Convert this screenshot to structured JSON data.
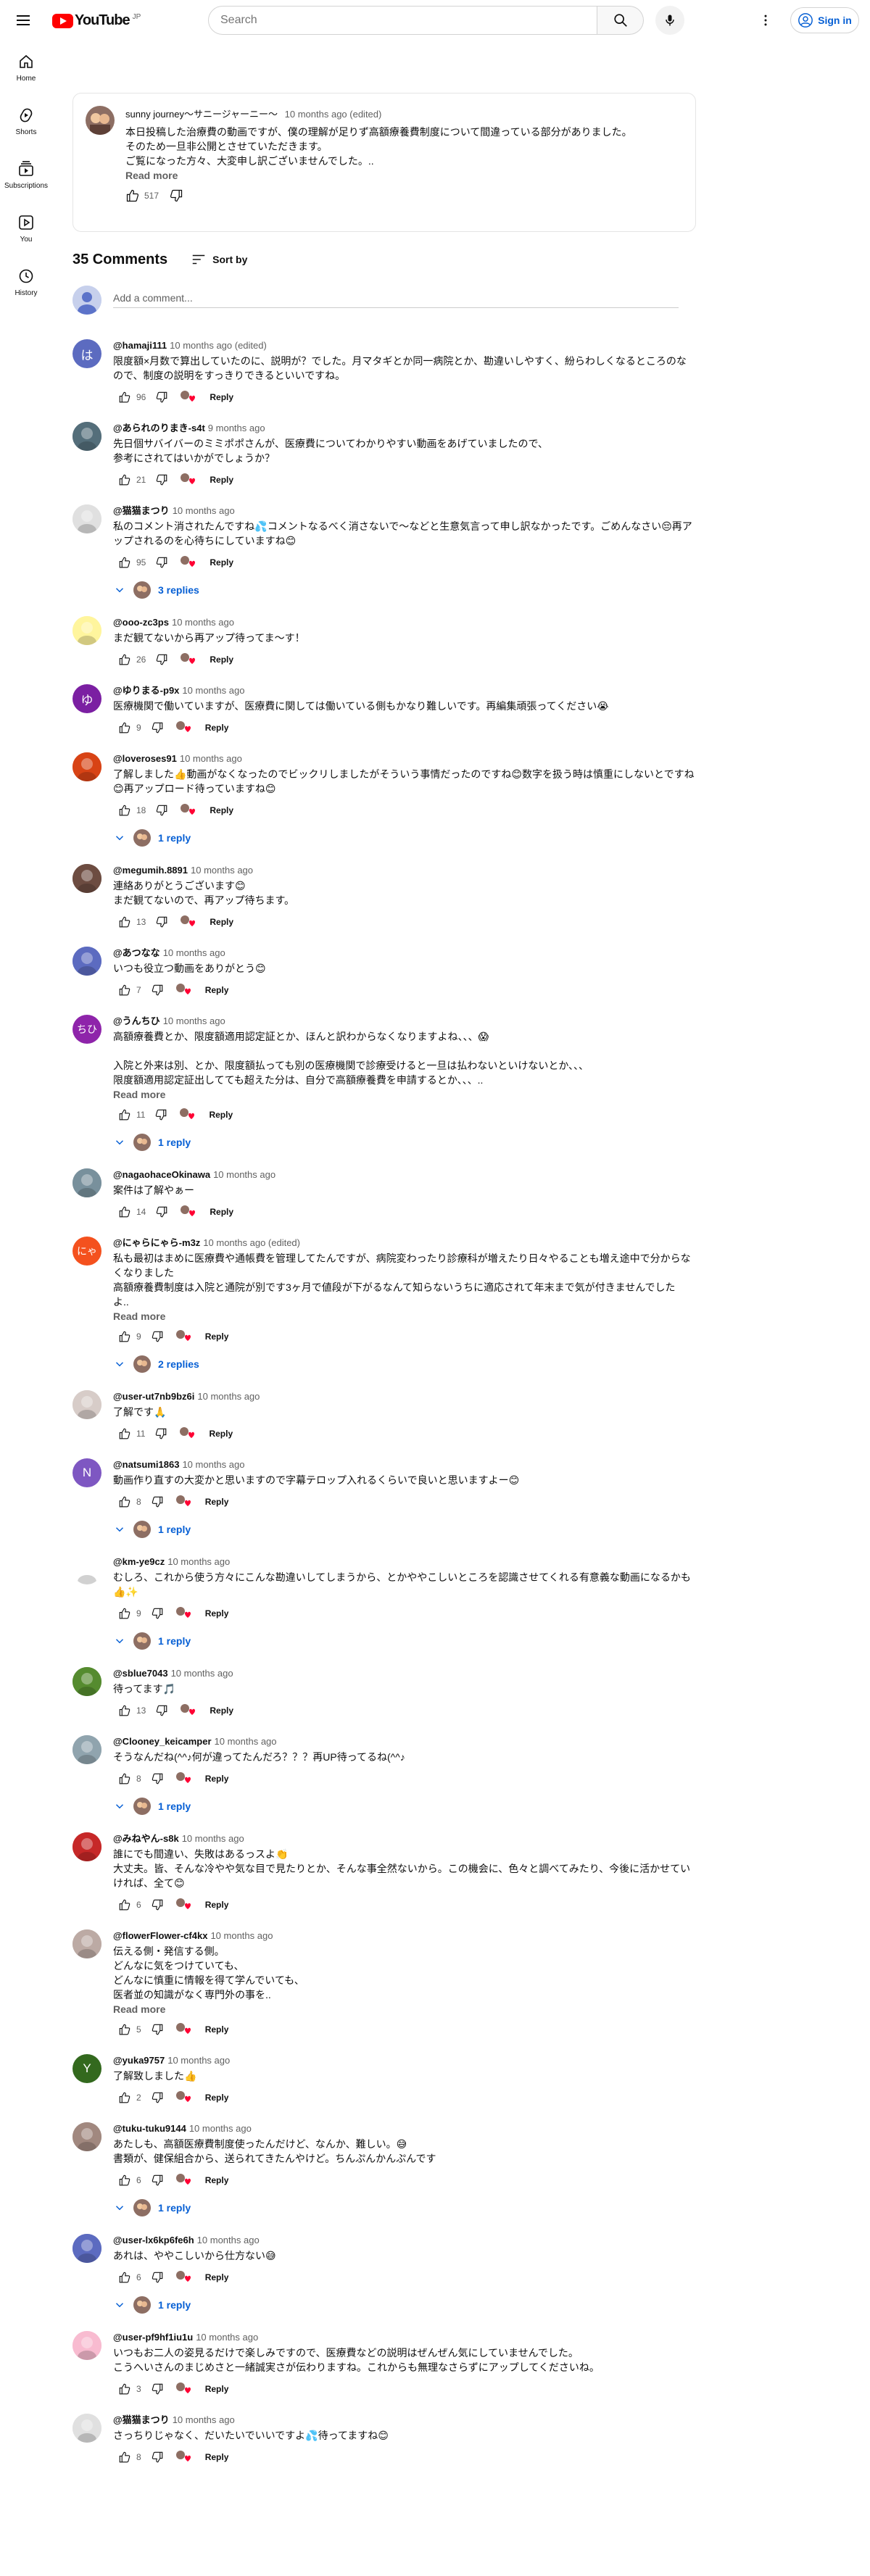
{
  "header": {
    "logo_text": "YouTube",
    "logo_region": "JP",
    "search_placeholder": "Search",
    "signin_label": "Sign in"
  },
  "sidebar": [
    {
      "label": "Home",
      "icon": "home-icon"
    },
    {
      "label": "Shorts",
      "icon": "shorts-icon"
    },
    {
      "label": "Subscriptions",
      "icon": "subscriptions-icon"
    },
    {
      "label": "You",
      "icon": "you-icon"
    },
    {
      "label": "History",
      "icon": "history-icon"
    }
  ],
  "post": {
    "author": "sunny journey～サニージャーニー～",
    "time": "10 months ago (edited)",
    "text": "本日投稿した治療費の動画ですが、僕の理解が足りず高額療養費制度について間違っている部分がありました。\nそのため一旦非公開とさせていただきます。\nご覧になった方々、大変申し訳ございませんでした。..",
    "read_more": "Read more",
    "likes": "517"
  },
  "comments_header": {
    "count": "35 Comments",
    "sort_label": "Sort by"
  },
  "add_comment": {
    "placeholder": "Add a comment..."
  },
  "reply_label": "Reply",
  "read_more_label": "Read more",
  "comments": [
    {
      "author": "@hamaji111",
      "time": "10 months ago (edited)",
      "text": "限度額×月数で算出していたのに、説明が？でした。月マタギとか同一病院とか、勘違いしやすく、紛らわしくなるところのなので、制度の説明をすっきりできるといいですね。",
      "likes": "96",
      "avatar": {
        "type": "letter",
        "letter": "は",
        "color": "#5c6bc0"
      }
    },
    {
      "author": "@あられのりまき-s4t",
      "time": "9 months ago",
      "text": "先日個サバイバーのミミポポさんが、医療費についてわかりやすい動画をあげていましたので、\n参考にされてはいかがでしょうか？",
      "likes": "21",
      "avatar": {
        "type": "photo",
        "color": "#546e7a"
      }
    },
    {
      "author": "@猫猫まつり",
      "time": "10 months ago",
      "text": "私のコメント消されたんですね💦コメントなるべく消さないで〜などと生意気言って申し訳なかったです。ごめんなさい😔再アップされるのを心待ちにしていますね😊",
      "likes": "95",
      "avatar": {
        "type": "photo",
        "color": "#e0e0e0"
      },
      "replies": "3 replies"
    },
    {
      "author": "@ooo-zc3ps",
      "time": "10 months ago",
      "text": "まだ観てないから再アップ待ってま〜す！",
      "likes": "26",
      "avatar": {
        "type": "photo",
        "color": "#fff59d"
      }
    },
    {
      "author": "@ゆりまる-p9x",
      "time": "10 months ago",
      "text": "医療機関で働いていますが、医療費に関しては働いている側もかなり難しいです。再編集頑張ってください😭",
      "likes": "9",
      "avatar": {
        "type": "letter",
        "letter": "ゆ",
        "color": "#7b1fa2"
      }
    },
    {
      "author": "@loveroses91",
      "time": "10 months ago",
      "text": "了解しました👍動画がなくなったのでビックリしましたがそういう事情だったのですね😊数字を扱う時は慎重にしないとですね😊再アップロード待っていますね😊",
      "likes": "18",
      "avatar": {
        "type": "photo",
        "color": "#d84315"
      },
      "replies": "1 reply"
    },
    {
      "author": "@megumih.8891",
      "time": "10 months ago",
      "text": "連絡ありがとうございます😊\nまだ観てないので、再アップ待ちます。",
      "likes": "13",
      "avatar": {
        "type": "photo",
        "color": "#6d4c41"
      }
    },
    {
      "author": "@あつなな",
      "time": "10 months ago",
      "text": "いつも役立つ動画をありがとう😊",
      "likes": "7",
      "avatar": {
        "type": "photo",
        "color": "#5c6bc0"
      }
    },
    {
      "author": "@うんちひ",
      "time": "10 months ago",
      "text": "高額療養費とか、限度額適用認定証とか、ほんと訳わからなくなりますよね、、、😱\n\n入院と外来は別、とか、限度額払っても別の医療機関で診療受けると一旦は払わないといけないとか、、、\n限度額適用認定証出してても超えた分は、自分で高額療養費を申請するとか、、、..",
      "likes": "11",
      "avatar": {
        "type": "letter",
        "letter": "ちひ",
        "color": "#8e24aa"
      },
      "read_more": true,
      "replies": "1 reply"
    },
    {
      "author": "@nagaohaceOkinawa",
      "time": "10 months ago",
      "text": "案件は了解やぁー",
      "likes": "14",
      "avatar": {
        "type": "photo",
        "color": "#78909c"
      }
    },
    {
      "author": "@にゃらにゃら-m3z",
      "time": "10 months ago (edited)",
      "text": "私も最初はまめに医療費や通帳費を管理してたんですが、病院変わったり診療科が増えたり日々やることも増え途中で分からなくなりました\n高額療養費制度は入院と通院が別です3ヶ月で値段が下がるなんて知らないうちに適応されて年末まで気が付きませんでした\nよ..",
      "likes": "9",
      "avatar": {
        "type": "letter",
        "letter": "にゃ",
        "color": "#f4511e"
      },
      "read_more": true,
      "replies": "2 replies"
    },
    {
      "author": "@user-ut7nb9bz6i",
      "time": "10 months ago",
      "text": "了解です🙏",
      "likes": "11",
      "avatar": {
        "type": "photo",
        "color": "#d7ccc8"
      }
    },
    {
      "author": "@natsumi1863",
      "time": "10 months ago",
      "text": "動画作り直すの大変かと思いますので字幕テロップ入れるくらいで良いと思いますよー😊",
      "likes": "8",
      "avatar": {
        "type": "letter",
        "letter": "N",
        "color": "#7e57c2"
      },
      "replies": "1 reply"
    },
    {
      "author": "@km-ye9cz",
      "time": "10 months ago",
      "text": "むしろ、これから使う方々にこんな勘違いしてしまうから、とかややこしいところを認識させてくれる有意義な動画になるかも👍✨",
      "likes": "9",
      "avatar": {
        "type": "photo",
        "color": "#ffffff"
      },
      "replies": "1 reply"
    },
    {
      "author": "@sblue7043",
      "time": "10 months ago",
      "text": "待ってます🎵",
      "likes": "13",
      "avatar": {
        "type": "photo",
        "color": "#558b2f"
      }
    },
    {
      "author": "@Clooney_keicamper",
      "time": "10 months ago",
      "text": "そうなんだね(^^♪何が違ってたんだろ？？？再UP待ってるね(^^♪",
      "likes": "8",
      "avatar": {
        "type": "photo",
        "color": "#90a4ae"
      },
      "replies": "1 reply"
    },
    {
      "author": "@みねやん-s8k",
      "time": "10 months ago",
      "text": "誰にでも間違い、失敗はあるっスよ👏\n大丈夫。皆、そんな冷やや気な目で見たりとか、そんな事全然ないから。この機会に、色々と調べてみたり、今後に活かせていければ、全て😊",
      "likes": "6",
      "avatar": {
        "type": "photo",
        "color": "#c62828"
      }
    },
    {
      "author": "@flowerFlower-cf4kx",
      "time": "10 months ago",
      "text": "伝える側・発信する側。\nどんなに気をつけていても、\nどんなに慎重に情報を得て学んでいても、\n医者並の知識がなく専門外の事を..",
      "likes": "5",
      "avatar": {
        "type": "photo",
        "color": "#bcaaa4"
      },
      "read_more": true
    },
    {
      "author": "@yuka9757",
      "time": "10 months ago",
      "text": "了解致しました👍",
      "likes": "2",
      "avatar": {
        "type": "letter",
        "letter": "Y",
        "color": "#33691e"
      }
    },
    {
      "author": "@tuku-tuku9144",
      "time": "10 months ago",
      "text": "あたしも、高額医療費制度使ったんだけど、なんか、難しい。😅\n書類が、健保組合から、送られてきたんやけど。ちんぷんかんぷんです",
      "likes": "6",
      "avatar": {
        "type": "photo",
        "color": "#a1887f"
      },
      "replies": "1 reply"
    },
    {
      "author": "@user-lx6kp6fe6h",
      "time": "10 months ago",
      "text": "あれは、ややこしいから仕方ない😅",
      "likes": "6",
      "avatar": {
        "type": "photo",
        "color": "#5c6bc0"
      },
      "replies": "1 reply"
    },
    {
      "author": "@user-pf9hf1iu1u",
      "time": "10 months ago",
      "text": "いつもお二人の姿見るだけで楽しみですので、医療費などの説明はぜんぜん気にしていませんでした。\nこうへいさんのまじめさと一緒誠実さが伝わりますね。これからも無理なさらずにアップしてくださいね。",
      "likes": "3",
      "avatar": {
        "type": "photo",
        "color": "#f8bbd0"
      }
    },
    {
      "author": "@猫猫まつり",
      "time": "10 months ago",
      "text": "さっちりじゃなく、だいたいでいいですよ💦待ってますね😊",
      "likes": "8",
      "avatar": {
        "type": "photo",
        "color": "#e0e0e0"
      }
    }
  ]
}
